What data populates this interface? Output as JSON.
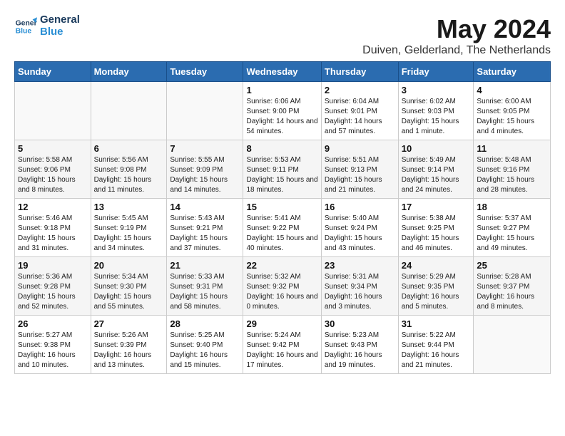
{
  "logo": {
    "line1": "General",
    "line2": "Blue"
  },
  "title": "May 2024",
  "location": "Duiven, Gelderland, The Netherlands",
  "headers": [
    "Sunday",
    "Monday",
    "Tuesday",
    "Wednesday",
    "Thursday",
    "Friday",
    "Saturday"
  ],
  "rows": [
    [
      {
        "day": "",
        "info": ""
      },
      {
        "day": "",
        "info": ""
      },
      {
        "day": "",
        "info": ""
      },
      {
        "day": "1",
        "info": "Sunrise: 6:06 AM\nSunset: 9:00 PM\nDaylight: 14 hours\nand 54 minutes."
      },
      {
        "day": "2",
        "info": "Sunrise: 6:04 AM\nSunset: 9:01 PM\nDaylight: 14 hours\nand 57 minutes."
      },
      {
        "day": "3",
        "info": "Sunrise: 6:02 AM\nSunset: 9:03 PM\nDaylight: 15 hours\nand 1 minute."
      },
      {
        "day": "4",
        "info": "Sunrise: 6:00 AM\nSunset: 9:05 PM\nDaylight: 15 hours\nand 4 minutes."
      }
    ],
    [
      {
        "day": "5",
        "info": "Sunrise: 5:58 AM\nSunset: 9:06 PM\nDaylight: 15 hours\nand 8 minutes."
      },
      {
        "day": "6",
        "info": "Sunrise: 5:56 AM\nSunset: 9:08 PM\nDaylight: 15 hours\nand 11 minutes."
      },
      {
        "day": "7",
        "info": "Sunrise: 5:55 AM\nSunset: 9:09 PM\nDaylight: 15 hours\nand 14 minutes."
      },
      {
        "day": "8",
        "info": "Sunrise: 5:53 AM\nSunset: 9:11 PM\nDaylight: 15 hours\nand 18 minutes."
      },
      {
        "day": "9",
        "info": "Sunrise: 5:51 AM\nSunset: 9:13 PM\nDaylight: 15 hours\nand 21 minutes."
      },
      {
        "day": "10",
        "info": "Sunrise: 5:49 AM\nSunset: 9:14 PM\nDaylight: 15 hours\nand 24 minutes."
      },
      {
        "day": "11",
        "info": "Sunrise: 5:48 AM\nSunset: 9:16 PM\nDaylight: 15 hours\nand 28 minutes."
      }
    ],
    [
      {
        "day": "12",
        "info": "Sunrise: 5:46 AM\nSunset: 9:18 PM\nDaylight: 15 hours\nand 31 minutes."
      },
      {
        "day": "13",
        "info": "Sunrise: 5:45 AM\nSunset: 9:19 PM\nDaylight: 15 hours\nand 34 minutes."
      },
      {
        "day": "14",
        "info": "Sunrise: 5:43 AM\nSunset: 9:21 PM\nDaylight: 15 hours\nand 37 minutes."
      },
      {
        "day": "15",
        "info": "Sunrise: 5:41 AM\nSunset: 9:22 PM\nDaylight: 15 hours\nand 40 minutes."
      },
      {
        "day": "16",
        "info": "Sunrise: 5:40 AM\nSunset: 9:24 PM\nDaylight: 15 hours\nand 43 minutes."
      },
      {
        "day": "17",
        "info": "Sunrise: 5:38 AM\nSunset: 9:25 PM\nDaylight: 15 hours\nand 46 minutes."
      },
      {
        "day": "18",
        "info": "Sunrise: 5:37 AM\nSunset: 9:27 PM\nDaylight: 15 hours\nand 49 minutes."
      }
    ],
    [
      {
        "day": "19",
        "info": "Sunrise: 5:36 AM\nSunset: 9:28 PM\nDaylight: 15 hours\nand 52 minutes."
      },
      {
        "day": "20",
        "info": "Sunrise: 5:34 AM\nSunset: 9:30 PM\nDaylight: 15 hours\nand 55 minutes."
      },
      {
        "day": "21",
        "info": "Sunrise: 5:33 AM\nSunset: 9:31 PM\nDaylight: 15 hours\nand 58 minutes."
      },
      {
        "day": "22",
        "info": "Sunrise: 5:32 AM\nSunset: 9:32 PM\nDaylight: 16 hours\nand 0 minutes."
      },
      {
        "day": "23",
        "info": "Sunrise: 5:31 AM\nSunset: 9:34 PM\nDaylight: 16 hours\nand 3 minutes."
      },
      {
        "day": "24",
        "info": "Sunrise: 5:29 AM\nSunset: 9:35 PM\nDaylight: 16 hours\nand 5 minutes."
      },
      {
        "day": "25",
        "info": "Sunrise: 5:28 AM\nSunset: 9:37 PM\nDaylight: 16 hours\nand 8 minutes."
      }
    ],
    [
      {
        "day": "26",
        "info": "Sunrise: 5:27 AM\nSunset: 9:38 PM\nDaylight: 16 hours\nand 10 minutes."
      },
      {
        "day": "27",
        "info": "Sunrise: 5:26 AM\nSunset: 9:39 PM\nDaylight: 16 hours\nand 13 minutes."
      },
      {
        "day": "28",
        "info": "Sunrise: 5:25 AM\nSunset: 9:40 PM\nDaylight: 16 hours\nand 15 minutes."
      },
      {
        "day": "29",
        "info": "Sunrise: 5:24 AM\nSunset: 9:42 PM\nDaylight: 16 hours\nand 17 minutes."
      },
      {
        "day": "30",
        "info": "Sunrise: 5:23 AM\nSunset: 9:43 PM\nDaylight: 16 hours\nand 19 minutes."
      },
      {
        "day": "31",
        "info": "Sunrise: 5:22 AM\nSunset: 9:44 PM\nDaylight: 16 hours\nand 21 minutes."
      },
      {
        "day": "",
        "info": ""
      }
    ]
  ]
}
